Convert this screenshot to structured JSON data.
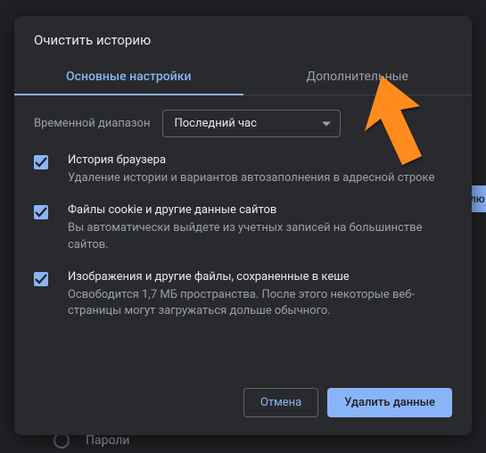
{
  "dialog": {
    "title": "Очистить историю",
    "tabs": {
      "basic": "Основные настройки",
      "advanced": "Дополнительные"
    },
    "timerange": {
      "label": "Временной диапазон",
      "value": "Последний час"
    },
    "options": [
      {
        "title": "История браузера",
        "desc": "Удаление истории и вариантов автозаполнения в адресной строке"
      },
      {
        "title": "Файлы cookie и другие данные сайтов",
        "desc": "Вы автоматически выйдете из учетных записей на большинстве сайтов."
      },
      {
        "title": "Изображения и другие файлы, сохраненные в кеше",
        "desc": "Освободится 1,7 МБ пространства. После этого некоторые веб-страницы могут загружаться дольше обычного."
      }
    ],
    "buttons": {
      "cancel": "Отмена",
      "confirm": "Удалить данные"
    }
  },
  "background": {
    "passwords": "Пароли",
    "side_fragment": "лю"
  }
}
